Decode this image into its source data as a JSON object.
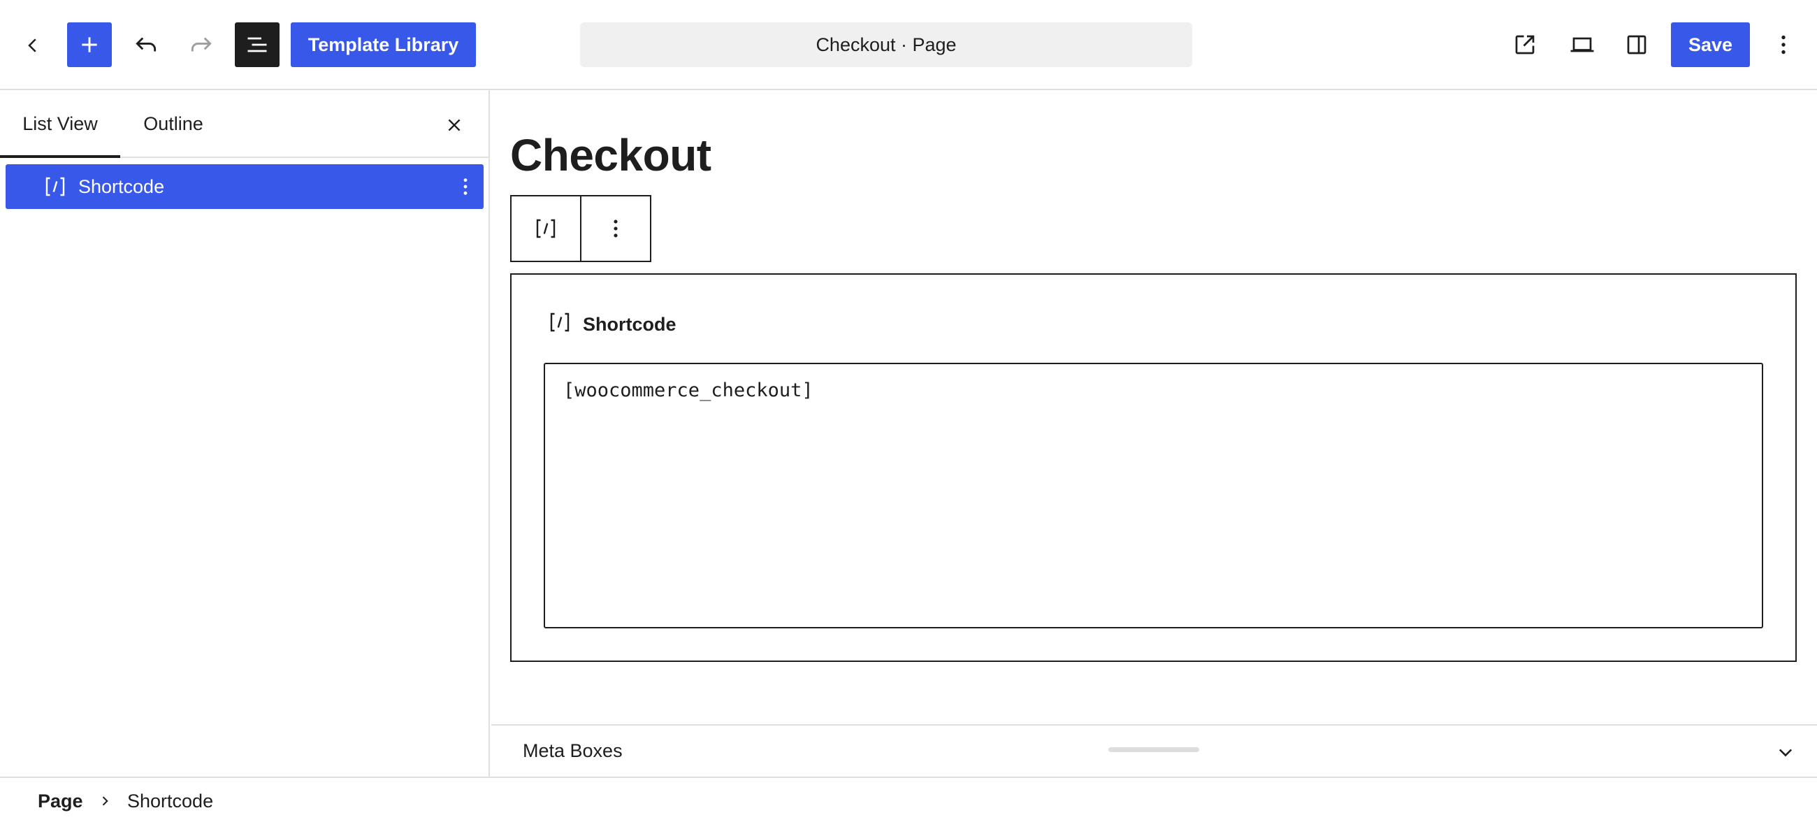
{
  "toolbar": {
    "back_icon": "chevron-left-icon",
    "add_icon": "plus-icon",
    "undo_icon": "undo-icon",
    "redo_icon": "redo-icon",
    "document_overview_icon": "list-view-icon",
    "template_library_label": "Template Library",
    "document_title": "Checkout · Page",
    "view_page_icon": "external-link-icon",
    "device_preview_icon": "laptop-icon",
    "settings_icon": "sidebar-panel-icon",
    "save_label": "Save",
    "options_icon": "more-vertical-icon"
  },
  "sidebar": {
    "tabs": [
      {
        "label": "List View",
        "active": true
      },
      {
        "label": "Outline",
        "active": false
      }
    ],
    "close_icon": "close-icon",
    "items": [
      {
        "label": "Shortcode",
        "icon": "shortcode-icon",
        "selected": true
      }
    ]
  },
  "canvas": {
    "page_title": "Checkout",
    "block_toolbar": {
      "block_icon": "shortcode-icon",
      "options_icon": "more-vertical-icon"
    },
    "shortcode_block": {
      "label": "Shortcode",
      "icon": "shortcode-icon",
      "value": "[woocommerce_checkout]"
    }
  },
  "meta_boxes": {
    "label": "Meta Boxes",
    "toggle_icon": "chevron-down-icon"
  },
  "breadcrumb": {
    "items": [
      "Page",
      "Shortcode"
    ]
  },
  "colors": {
    "accent": "#3858e9",
    "dark": "#1e1e1e",
    "border": "#e0e0e0",
    "title_bar": "#f0f0f0"
  }
}
